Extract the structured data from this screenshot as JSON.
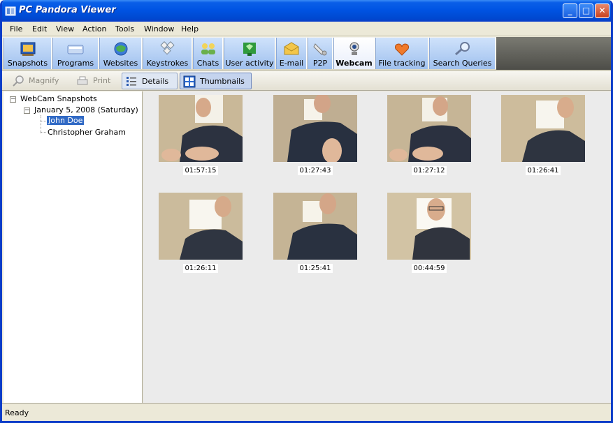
{
  "window": {
    "title": "PC Pandora Viewer"
  },
  "menu": [
    {
      "label": "File"
    },
    {
      "label": "Edit"
    },
    {
      "label": "View"
    },
    {
      "label": "Action"
    },
    {
      "label": "Tools"
    },
    {
      "label": "Window"
    },
    {
      "label": "Help"
    }
  ],
  "toolbar": {
    "tools": [
      {
        "label": "Snapshots",
        "icon": "snapshots-icon"
      },
      {
        "label": "Programs",
        "icon": "programs-icon"
      },
      {
        "label": "Websites",
        "icon": "websites-icon"
      },
      {
        "label": "Keystrokes",
        "icon": "keystrokes-icon"
      },
      {
        "label": "Chats",
        "icon": "chats-icon"
      },
      {
        "label": "User activity",
        "icon": "user-activity-icon"
      },
      {
        "label": "E-mail",
        "icon": "email-icon"
      },
      {
        "label": "P2P",
        "icon": "p2p-icon"
      },
      {
        "label": "Webcam",
        "icon": "webcam-icon"
      },
      {
        "label": "File tracking",
        "icon": "file-tracking-icon"
      },
      {
        "label": "Search Queries",
        "icon": "search-queries-icon"
      }
    ],
    "active": "Webcam"
  },
  "view_toolbar": {
    "magnify": "Magnify",
    "print": "Print",
    "details": "Details",
    "thumbnails": "Thumbnails"
  },
  "tree": {
    "root": "WebCam Snapshots",
    "date": "January 5, 2008 (Saturday)",
    "users": [
      {
        "label": "John Doe",
        "selected": true
      },
      {
        "label": "Christopher Graham",
        "selected": false
      }
    ]
  },
  "thumbnails": [
    {
      "time": "01:57:15"
    },
    {
      "time": "01:27:43"
    },
    {
      "time": "01:27:12"
    },
    {
      "time": "01:26:41"
    },
    {
      "time": "01:26:11"
    },
    {
      "time": "01:25:41"
    },
    {
      "time": "00:44:59"
    }
  ],
  "status": {
    "text": "Ready"
  },
  "colors": {
    "titlebar": "#0054e3",
    "selection": "#316ac5",
    "toolbar_blue": "#9fc0ee"
  }
}
